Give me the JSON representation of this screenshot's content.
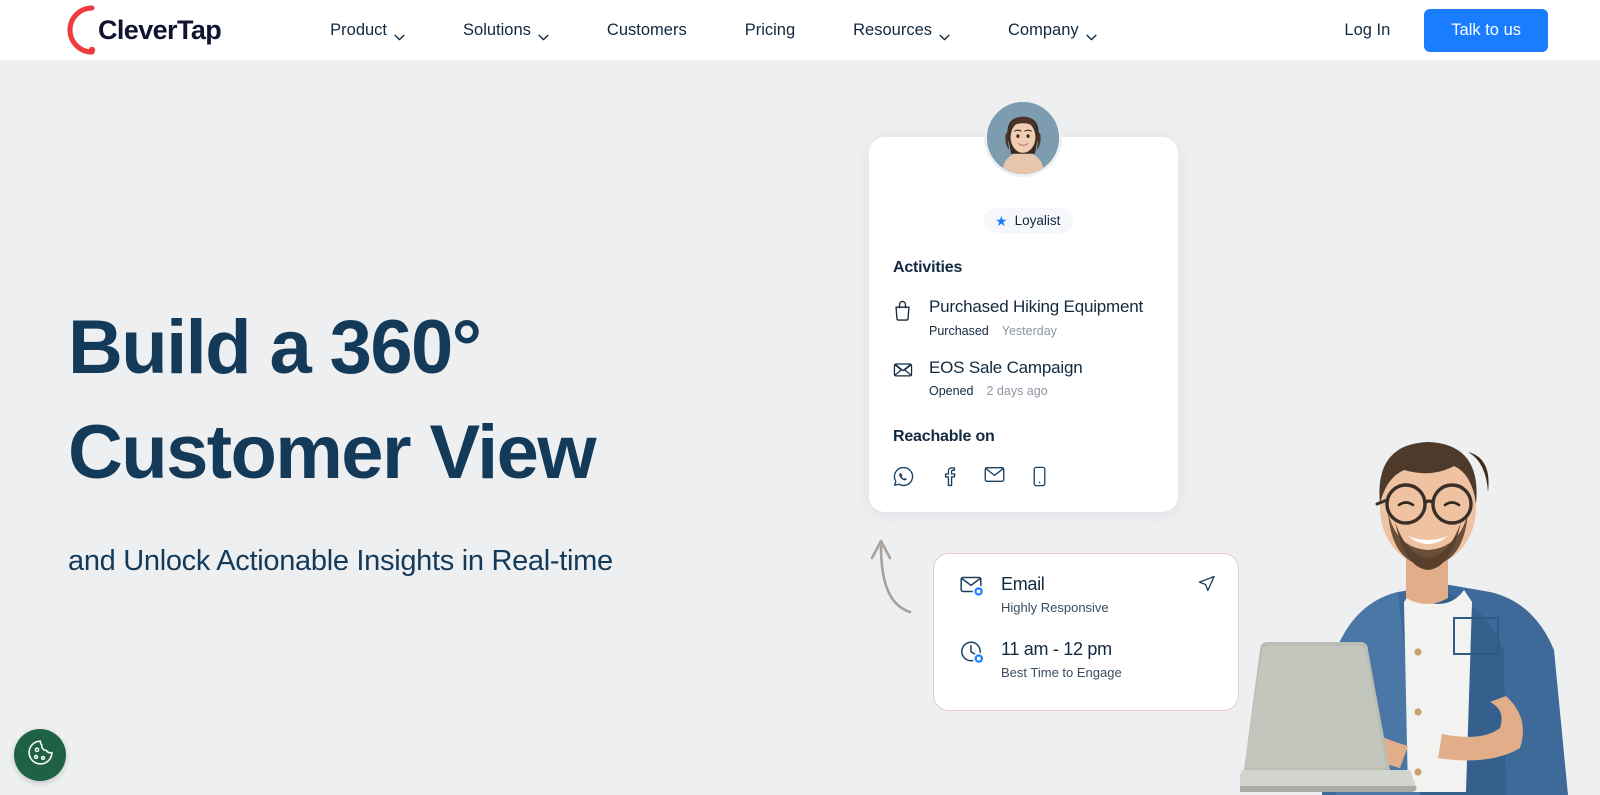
{
  "brand": {
    "name": "CleverTap",
    "logo_icon": "clevertap-arc-logo",
    "accent": "#ef3a3f"
  },
  "nav": {
    "items": [
      {
        "label": "Product",
        "has_dropdown": true,
        "icon": "chevron-down-icon"
      },
      {
        "label": "Solutions",
        "has_dropdown": true,
        "icon": "chevron-down-icon"
      },
      {
        "label": "Customers",
        "has_dropdown": false,
        "icon": ""
      },
      {
        "label": "Pricing",
        "has_dropdown": false,
        "icon": ""
      },
      {
        "label": "Resources",
        "has_dropdown": true,
        "icon": "chevron-down-icon"
      },
      {
        "label": "Company",
        "has_dropdown": true,
        "icon": "chevron-down-icon"
      }
    ],
    "login_label": "Log In",
    "cta_label": "Talk to us",
    "cta_color": "#1a7cff"
  },
  "hero": {
    "headline_line1": "Build a 360°",
    "headline_line2": "Customer View",
    "subheadline": "and Unlock Actionable Insights in Real-time",
    "headline_color": "#143a5a",
    "background_color": "#eeeff1"
  },
  "profile_card": {
    "avatar_icon": "user-avatar-photo",
    "badge": {
      "label": "Loyalist",
      "icon": "star-icon",
      "icon_color": "#1a7cff"
    },
    "activities_title": "Activities",
    "activities": [
      {
        "icon": "shopping-bag-icon",
        "title": "Purchased Hiking Equipment",
        "status": "Purchased",
        "time": "Yesterday"
      },
      {
        "icon": "envelope-open-icon",
        "title": "EOS Sale Campaign",
        "status": "Opened",
        "time": "2 days ago"
      }
    ],
    "reachable_title": "Reachable on",
    "reachable_channels": [
      {
        "icon": "whatsapp-icon",
        "label": "WhatsApp"
      },
      {
        "icon": "facebook-icon",
        "label": "Facebook"
      },
      {
        "icon": "email-icon",
        "label": "Email"
      },
      {
        "icon": "mobile-phone-icon",
        "label": "Mobile"
      }
    ]
  },
  "email_card": {
    "border_color": "#e7cdc2",
    "send_icon": "send-paper-plane-icon",
    "rows": [
      {
        "icon": "envelope-check-icon",
        "title": "Email",
        "subtitle": "Highly Responsive"
      },
      {
        "icon": "clock-check-icon",
        "title": "11 am - 12 pm",
        "subtitle": "Best Time to Engage"
      }
    ]
  },
  "decor": {
    "arrow_icon": "curved-up-arrow-icon",
    "person_image": "man-with-laptop-photo"
  },
  "cookie_consent": {
    "icon": "cookie-icon",
    "color": "#1f6145"
  }
}
